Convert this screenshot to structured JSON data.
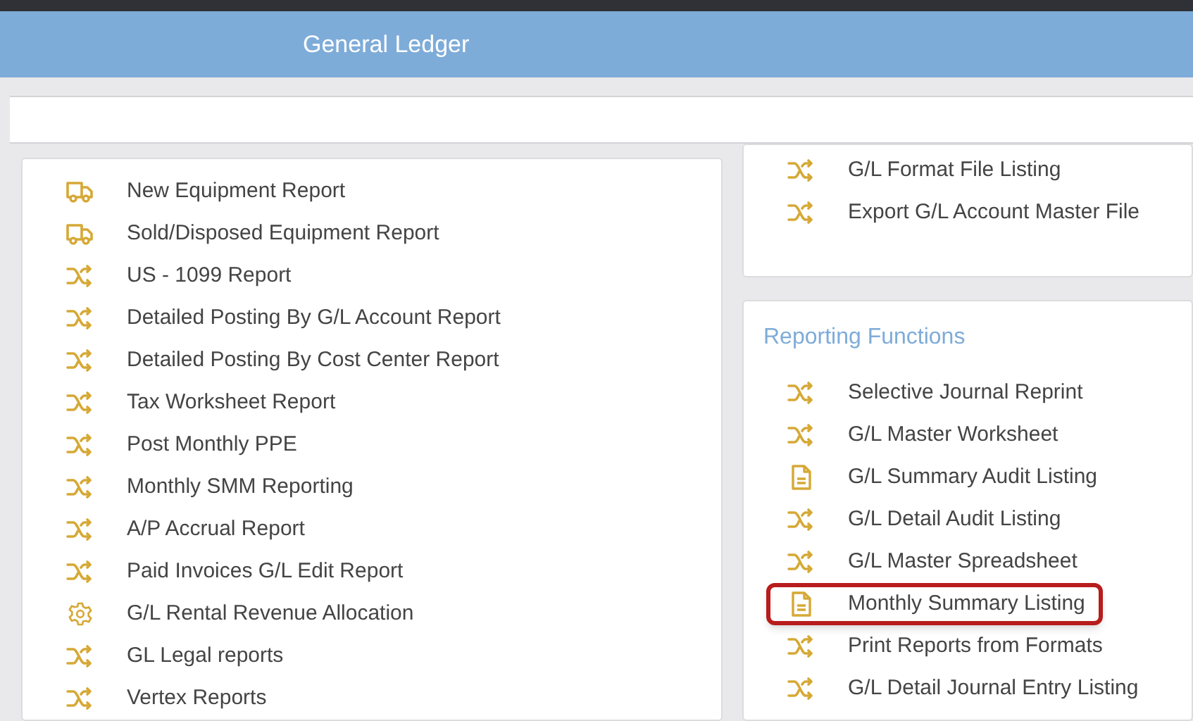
{
  "header": {
    "title": "General Ledger"
  },
  "left_panel": {
    "items": [
      {
        "label": "New Equipment Report",
        "kind": "truck",
        "highlighted": false
      },
      {
        "label": "Sold/Disposed Equipment Report",
        "kind": "truck",
        "highlighted": false
      },
      {
        "label": "US - 1099 Report",
        "kind": "shuffle",
        "highlighted": false
      },
      {
        "label": "Detailed Posting By G/L Account Report",
        "kind": "shuffle",
        "highlighted": false
      },
      {
        "label": "Detailed Posting By Cost Center Report",
        "kind": "shuffle",
        "highlighted": false
      },
      {
        "label": "Tax Worksheet Report",
        "kind": "shuffle",
        "highlighted": false
      },
      {
        "label": "Post Monthly PPE",
        "kind": "shuffle",
        "highlighted": false
      },
      {
        "label": "Monthly SMM Reporting",
        "kind": "shuffle",
        "highlighted": false
      },
      {
        "label": "A/P Accrual Report",
        "kind": "shuffle",
        "highlighted": false
      },
      {
        "label": "Paid Invoices G/L Edit Report",
        "kind": "shuffle",
        "highlighted": false
      },
      {
        "label": "G/L Rental Revenue Allocation",
        "kind": "gear",
        "highlighted": false
      },
      {
        "label": "GL Legal reports",
        "kind": "shuffle",
        "highlighted": false
      },
      {
        "label": "Vertex Reports",
        "kind": "shuffle",
        "highlighted": false
      }
    ]
  },
  "right_top_panel": {
    "items": [
      {
        "label": "G/L Format File Listing",
        "kind": "shuffle",
        "highlighted": false
      },
      {
        "label": "Export G/L Account Master File",
        "kind": "shuffle",
        "highlighted": false
      }
    ]
  },
  "reporting_functions": {
    "title": "Reporting Functions",
    "items": [
      {
        "label": "Selective Journal Reprint",
        "kind": "shuffle",
        "highlighted": false
      },
      {
        "label": "G/L Master Worksheet",
        "kind": "shuffle",
        "highlighted": false
      },
      {
        "label": "G/L Summary Audit Listing",
        "kind": "document",
        "highlighted": false
      },
      {
        "label": "G/L Detail Audit Listing",
        "kind": "shuffle",
        "highlighted": false
      },
      {
        "label": "G/L Master Spreadsheet",
        "kind": "shuffle",
        "highlighted": false
      },
      {
        "label": "Monthly Summary Listing",
        "kind": "document",
        "highlighted": true
      },
      {
        "label": "Print Reports from Formats",
        "kind": "shuffle",
        "highlighted": false
      },
      {
        "label": "G/L Detail Journal Entry Listing",
        "kind": "shuffle",
        "highlighted": false
      }
    ]
  }
}
